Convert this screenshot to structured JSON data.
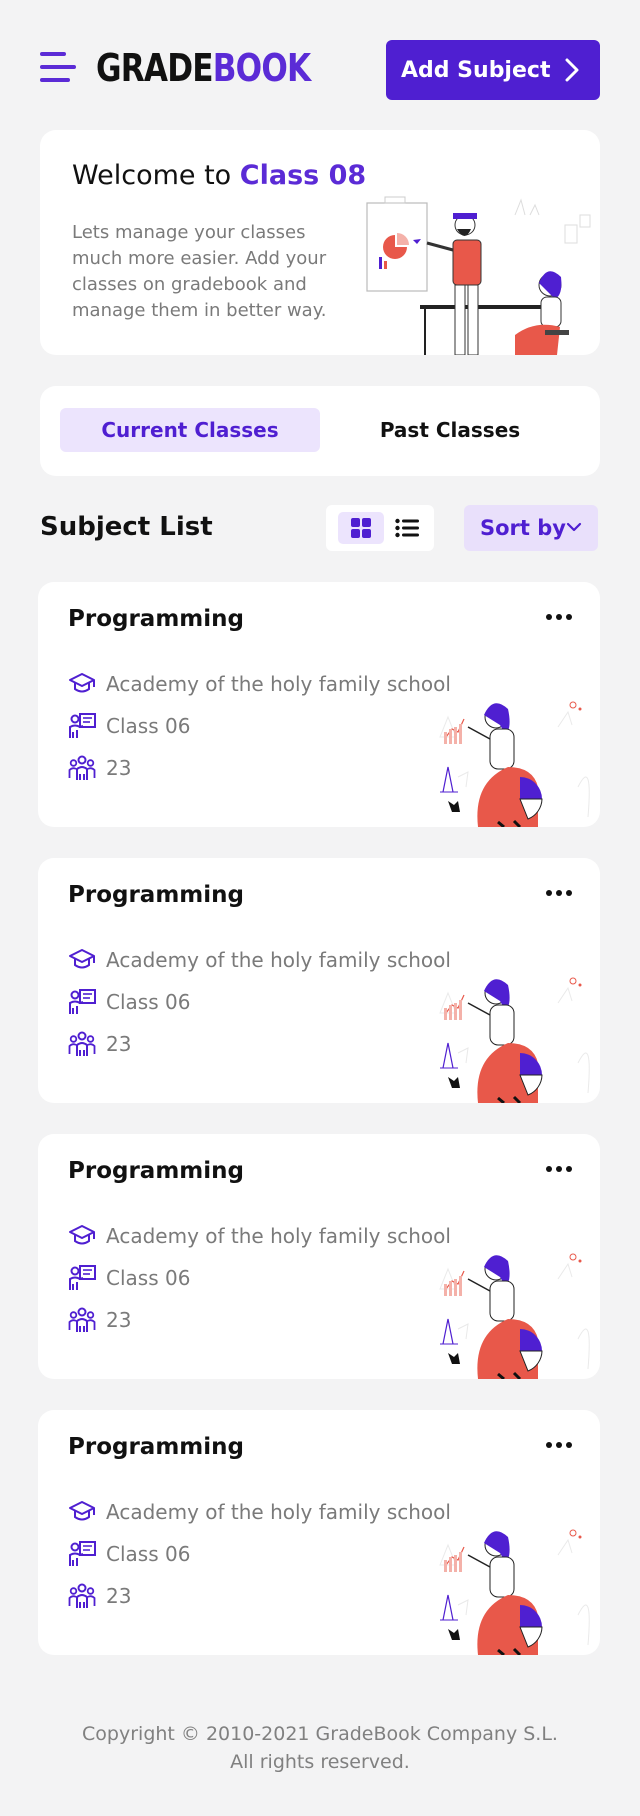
{
  "header": {
    "logo_part1": "GRADE",
    "logo_part2": "BOOK",
    "add_button_label": "Add Subject"
  },
  "welcome": {
    "greeting": "Welcome to ",
    "class_name": "Class 08",
    "description": "Lets manage your classes much more easier. Add your classes on gradebook and manage them in better way."
  },
  "tabs": [
    {
      "label": "Current Classes",
      "active": true
    },
    {
      "label": "Past Classes",
      "active": false
    }
  ],
  "subject_list": {
    "title": "Subject List",
    "sort_label": "Sort by",
    "view_mode": "grid"
  },
  "cards": [
    {
      "title": "Programming",
      "school": "Academy of the holy family school",
      "class_name": "Class 06",
      "students": "23"
    },
    {
      "title": "Programming",
      "school": "Academy of the holy family school",
      "class_name": "Class 06",
      "students": "23"
    },
    {
      "title": "Programming",
      "school": "Academy of the holy family school",
      "class_name": "Class 06",
      "students": "23"
    },
    {
      "title": "Programming",
      "school": "Academy of the holy family school",
      "class_name": "Class 06",
      "students": "23"
    }
  ],
  "footer": {
    "copyright": "Copyright © 2010-2021 GradeBook Company S.L. All rights reserved."
  },
  "colors": {
    "accent": "#4f1fd1",
    "accent_light": "#ece4fd",
    "background": "#f3f3f4",
    "muted_text": "#7a7a7a",
    "illustration_red": "#e8584a"
  },
  "icons": {
    "menu": "hamburger-menu-icon",
    "add_chevron": "chevron-right-icon",
    "grid_view": "grid-view-icon",
    "list_view": "list-view-icon",
    "sort_chevron": "chevron-down-icon",
    "more": "more-options-icon",
    "school": "graduation-cap-icon",
    "class": "teacher-board-icon",
    "students": "students-group-icon"
  }
}
